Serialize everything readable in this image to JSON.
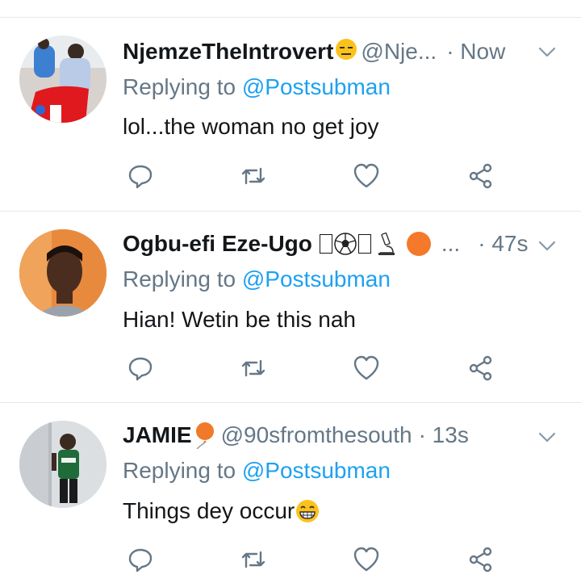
{
  "tweets": [
    {
      "name": "NjemzeTheIntrovert",
      "handle": "@Nje...",
      "time": "· Now",
      "reply_prefix": "Replying to ",
      "reply_to": "@Postsubman",
      "text": "lol...the woman no get joy"
    },
    {
      "name": "Ogbu-efi Eze-Ugo",
      "handle": "...",
      "time": "· 47s",
      "reply_prefix": "Replying to ",
      "reply_to": "@Postsubman",
      "text": "Hian! Wetin be this nah"
    },
    {
      "name": "JAMIE",
      "handle": "@90sfromthesouth",
      "time": "· 13s",
      "reply_prefix": "Replying to ",
      "reply_to": "@Postsubman",
      "text": "Things dey occur"
    }
  ],
  "icons": {
    "reply": "reply-icon",
    "retweet": "retweet-icon",
    "like": "heart-icon",
    "share": "share-icon",
    "more": "chevron-down-icon"
  },
  "colors": {
    "link": "#1da1f2",
    "secondary_text": "#657786",
    "primary_text": "#14171a",
    "divider": "#e1e8ed"
  }
}
